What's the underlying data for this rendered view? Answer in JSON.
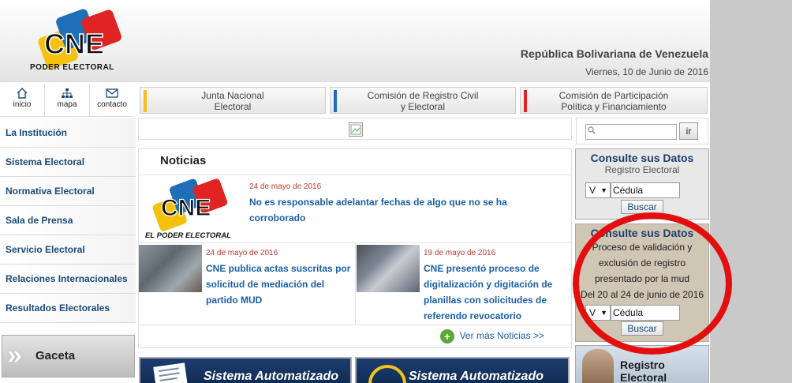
{
  "header": {
    "logo_text": "CNE",
    "logo_subtitle": "PODER ELECTORAL",
    "republic": "República Bolivariana de Venezuela",
    "date": "Viernes, 10 de Junio de 2016"
  },
  "iconnav": [
    {
      "label": "inicio",
      "icon": "home-icon"
    },
    {
      "label": "mapa",
      "icon": "sitemap-icon"
    },
    {
      "label": "contacto",
      "icon": "mail-icon"
    }
  ],
  "tabs": [
    {
      "line1": "Junta Nacional",
      "line2": "Electoral",
      "color": "#f2c11b"
    },
    {
      "line1": "Comisión de Registro Civil",
      "line2": "y Electoral",
      "color": "#1f6fb8"
    },
    {
      "line1": "Comisión de Participación",
      "line2": "Política y Financiamiento",
      "color": "#e02323"
    }
  ],
  "sidebar": {
    "items": [
      "La Institución",
      "Sistema Electoral",
      "Normativa Electoral",
      "Sala de Prensa",
      "Servicio Electoral",
      "Relaciones Internacionales",
      "Resultados Electorales"
    ],
    "gaceta": "Gaceta"
  },
  "news": {
    "title": "Noticias",
    "items": [
      {
        "date": "24 de mayo de 2016",
        "headline_lines": [
          "No es responsable adelantar fechas de algo que no se ha",
          "corroborado"
        ]
      },
      {
        "date": "24 de mayo de 2016",
        "headline_lines": [
          "CNE publica actas suscritas por",
          "solicitud de mediación del",
          "partido MUD"
        ]
      },
      {
        "date": "19 de mayo de 2016",
        "headline_lines": [
          "CNE presentó proceso de",
          "digitalización y digitación de",
          "planillas con solicitudes de",
          "referendo revocatorio"
        ]
      }
    ],
    "more": "Ver más Noticias >>",
    "thumb_logo_caption": "EL PODER ELECTORAL"
  },
  "bottom_banners": [
    {
      "label": "Sistema Automatizado"
    },
    {
      "label": "Sistema Automatizado"
    }
  ],
  "search": {
    "button": "ir",
    "value": ""
  },
  "consulta1": {
    "title": "Consulte sus Datos",
    "subtitle": "Registro Electoral",
    "nationality": "V",
    "cedula_placeholder": "Cédula",
    "button": "Buscar",
    "background": "#e8e8e8"
  },
  "consulta2": {
    "title": "Consulte sus Datos",
    "body_lines": [
      "Proceso de validación y",
      "exclusión de registro",
      "presentado por la mud",
      "Del 20 al 24 de junio de 2016"
    ],
    "nationality": "V",
    "cedula_placeholder": "Cédula",
    "button": "Buscar",
    "background": "#cfc6b4"
  },
  "registro": {
    "line1": "Registro",
    "line2": "Electoral"
  },
  "annotation_color": "#e30f0f"
}
